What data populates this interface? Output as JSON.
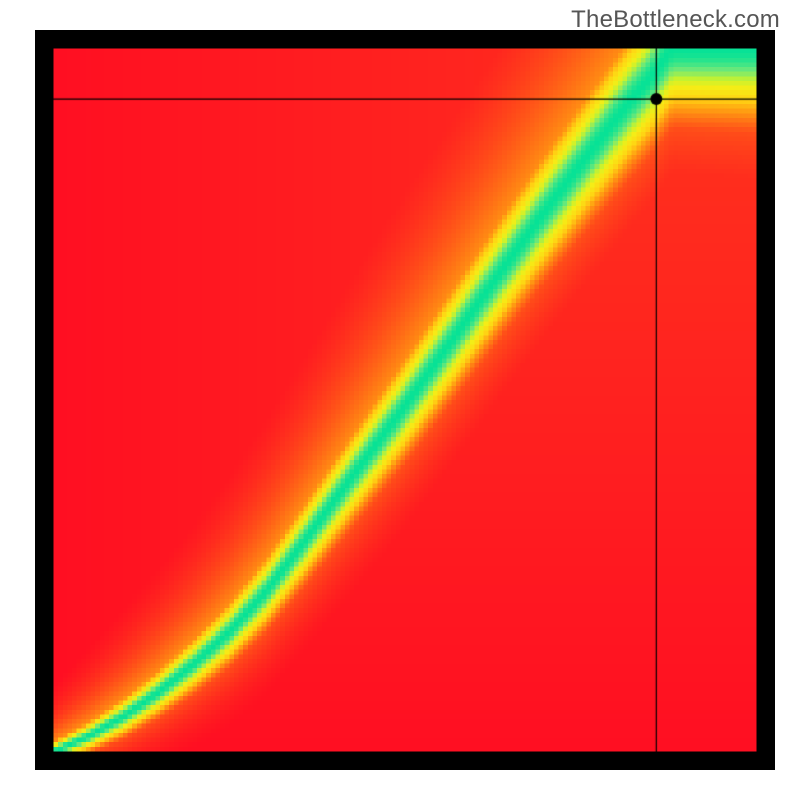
{
  "watermark": "TheBottleneck.com",
  "chart_data": {
    "type": "heatmap",
    "title": "",
    "xlabel": "",
    "ylabel": "",
    "xlim": [
      0,
      1
    ],
    "ylim": [
      0,
      1
    ],
    "grid": false,
    "legend": false,
    "border_px": 16,
    "resolution": 160,
    "crosshair": {
      "x": 0.855,
      "y": 0.925
    },
    "marker_radius_px": 6,
    "ridge_points": [
      [
        0.0,
        0.0
      ],
      [
        0.05,
        0.022
      ],
      [
        0.1,
        0.05
      ],
      [
        0.15,
        0.085
      ],
      [
        0.2,
        0.125
      ],
      [
        0.25,
        0.17
      ],
      [
        0.3,
        0.225
      ],
      [
        0.35,
        0.29
      ],
      [
        0.4,
        0.358
      ],
      [
        0.45,
        0.425
      ],
      [
        0.5,
        0.492
      ],
      [
        0.55,
        0.562
      ],
      [
        0.6,
        0.632
      ],
      [
        0.65,
        0.702
      ],
      [
        0.7,
        0.77
      ],
      [
        0.75,
        0.836
      ],
      [
        0.8,
        0.9
      ],
      [
        0.82,
        0.925
      ],
      [
        0.85,
        0.96
      ],
      [
        0.88,
        1.0
      ]
    ],
    "ridge_half_width": [
      [
        0.0,
        0.01
      ],
      [
        0.1,
        0.018
      ],
      [
        0.2,
        0.025
      ],
      [
        0.3,
        0.033
      ],
      [
        0.4,
        0.04
      ],
      [
        0.5,
        0.047
      ],
      [
        0.6,
        0.052
      ],
      [
        0.7,
        0.057
      ],
      [
        0.8,
        0.062
      ],
      [
        0.9,
        0.065
      ],
      [
        1.0,
        0.068
      ]
    ],
    "colormap": [
      [
        0.0,
        "#ff0024"
      ],
      [
        0.2,
        "#ff4a19"
      ],
      [
        0.4,
        "#ff9712"
      ],
      [
        0.55,
        "#ffd313"
      ],
      [
        0.7,
        "#f5ed16"
      ],
      [
        0.8,
        "#c7f22f"
      ],
      [
        0.9,
        "#6be87a"
      ],
      [
        1.0,
        "#06e296"
      ]
    ],
    "corner_tints": {
      "top_left": 0.05,
      "bottom_right": 0.05,
      "off_ridge_boost_right_of_ridge": 0.35
    }
  }
}
